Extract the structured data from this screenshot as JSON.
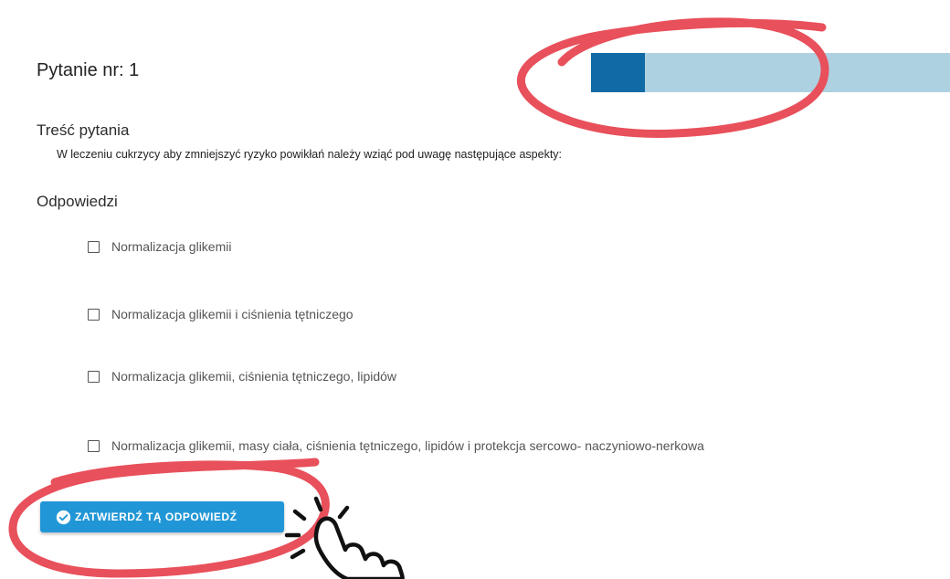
{
  "question": {
    "number_label": "Pytanie nr: 1",
    "progress_fraction": 0.15
  },
  "content": {
    "title": "Treść pytania",
    "text": "W leczeniu cukrzycy aby zmniejszyć ryzyko powikłań należy wziąć pod uwagę następujące aspekty:"
  },
  "answers": {
    "title": "Odpowiedzi",
    "items": [
      {
        "label": "Normalizacja glikemii",
        "checked": false
      },
      {
        "label": "Normalizacja glikemii i ciśnienia tętniczego",
        "checked": false
      },
      {
        "label": "Normalizacja glikemii, ciśnienia tętniczego, lipidów",
        "checked": false
      },
      {
        "label": "Normalizacja glikemii, masy ciała, ciśnienia tętniczego, lipidów i protekcja sercowo- naczyniowo-nerkowa",
        "checked": false
      }
    ]
  },
  "submit": {
    "label": "ZATWIERDŹ TĄ ODPOWIEDŹ"
  },
  "colors": {
    "accent": "#2196d7",
    "progress_fill": "#0f6aa6",
    "progress_track": "#aed1e1",
    "annotation": "#e8505b"
  },
  "icons": {
    "submit_icon": "check-circle-icon",
    "pointer_icon": "hand-pointer-icon"
  }
}
